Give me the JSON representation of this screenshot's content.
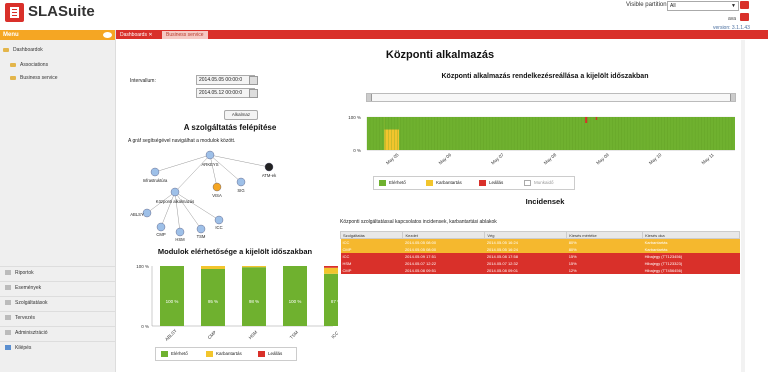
{
  "app": {
    "title": "SLASuite"
  },
  "header": {
    "partition_label": "Visible partition:",
    "partition_value": "All",
    "user": "ava",
    "version": "version: 3.1.1.43"
  },
  "sidebar": {
    "menu_label": "Menu",
    "items": [
      {
        "label": "Dashboardok"
      },
      {
        "label": "Associations"
      },
      {
        "label": "Business service"
      }
    ],
    "bottom": [
      {
        "label": "Riportok"
      },
      {
        "label": "Események"
      },
      {
        "label": "Szolgáltatások"
      },
      {
        "label": "Tervezés"
      },
      {
        "label": "Adminisztráció"
      },
      {
        "label": "Kilépés"
      }
    ]
  },
  "tabs": [
    {
      "label": "Dashboards"
    },
    {
      "label": "Business service"
    }
  ],
  "main": {
    "title": "Központi alkalmazás",
    "interval_label": "Intervallum:",
    "date_from": "2014.05.05 00:00:0",
    "date_to": "2014.05.12 00:00:0",
    "apply_label": "Alkalmaz",
    "structure_title": "A szolgáltatás felépítése",
    "structure_hint": "A gráf segítségével navigálhat a modulok között."
  },
  "graph": {
    "nodes": [
      {
        "label": "ARKEYS",
        "color": "#9ec0e8"
      },
      {
        "label": "Infrastruktúra",
        "color": "#9ec0e8"
      },
      {
        "label": "VISA",
        "color": "#f5a623"
      },
      {
        "label": "SIG",
        "color": "#9ec0e8"
      },
      {
        "label": "ATM-ek",
        "color": "#222222"
      },
      {
        "label": "Központi alkalmazás",
        "color": "#9ec0e8"
      },
      {
        "label": "ABLSY",
        "color": "#9ec0e8"
      },
      {
        "label": "CMP",
        "color": "#9ec0e8"
      },
      {
        "label": "HSM",
        "color": "#9ec0e8"
      },
      {
        "label": "TSM",
        "color": "#9ec0e8"
      },
      {
        "label": "ICC",
        "color": "#9ec0e8"
      }
    ]
  },
  "module_chart": {
    "title": "Modulok elérhetősége a kijelölt időszakban",
    "categories": [
      "ABLSY",
      "CMP",
      "HSM",
      "TSM",
      "ICC"
    ],
    "series": [
      {
        "name": "Elérhető",
        "color": "#6fb12f",
        "values": [
          100,
          95,
          98,
          100,
          87
        ]
      },
      {
        "name": "Karbantartás",
        "color": "#f2c52d",
        "values": [
          0,
          5,
          2,
          0,
          10
        ]
      },
      {
        "name": "Leállás",
        "color": "#d9302a",
        "values": [
          0,
          0,
          0,
          0,
          3
        ]
      }
    ],
    "labels": [
      "100 %",
      "95 %",
      "98 %",
      "100 %",
      "87 %"
    ],
    "y_ticks": [
      "100 %",
      "0 %"
    ]
  },
  "timeline": {
    "title": "Központi alkalmazás rendelkezésreállása a kijelölt időszakban",
    "x_ticks": [
      "May 05",
      "May 06",
      "May 07",
      "May 08",
      "May 09",
      "May 10",
      "May 11"
    ],
    "y_ticks": [
      "100 %",
      "0 %"
    ],
    "legend": [
      {
        "name": "Elérhető",
        "color": "#6fb12f"
      },
      {
        "name": "Karbantartás",
        "color": "#f2c52d"
      },
      {
        "name": "Leállás",
        "color": "#d9302a"
      },
      {
        "name": "Munkaidő",
        "color": "#dddddd"
      }
    ]
  },
  "incidents": {
    "title": "Incidensek",
    "subtitle": "Központi szolgáltatással kapcsolatos incidensek, karbantartási ablakok",
    "headers": [
      "Szolgáltatás",
      "Kezdet",
      "Vég",
      "Kiesés mértéke",
      "Kiesés oka"
    ],
    "rows": [
      {
        "service": "ICC",
        "start": "2014.05.05 08:00",
        "end": "2014.05.05 16:24",
        "severity": "80%",
        "cause": "Karbantartás",
        "color": "#f5b82e"
      },
      {
        "service": "CMP",
        "start": "2014.05.05 08:00",
        "end": "2014.05.05 16:24",
        "severity": "80%",
        "cause": "Karbantartás",
        "color": "#f5b82e"
      },
      {
        "service": "ICC",
        "start": "2014.05.09 17:51",
        "end": "2014.05.08 17:58",
        "severity": "15%",
        "cause": "Hibajegy (TT123456)",
        "color": "#d9302a"
      },
      {
        "service": "HSM",
        "start": "2014.05.07 12:22",
        "end": "2014.05.07 12:32",
        "severity": "15%",
        "cause": "Hibajegy (TT123323)",
        "color": "#d9302a"
      },
      {
        "service": "CMP",
        "start": "2014.05.08 09:51",
        "end": "2014.05.08 09:01",
        "severity": "12%",
        "cause": "Hibajegy (TT456456)",
        "color": "#d9302a"
      }
    ]
  }
}
